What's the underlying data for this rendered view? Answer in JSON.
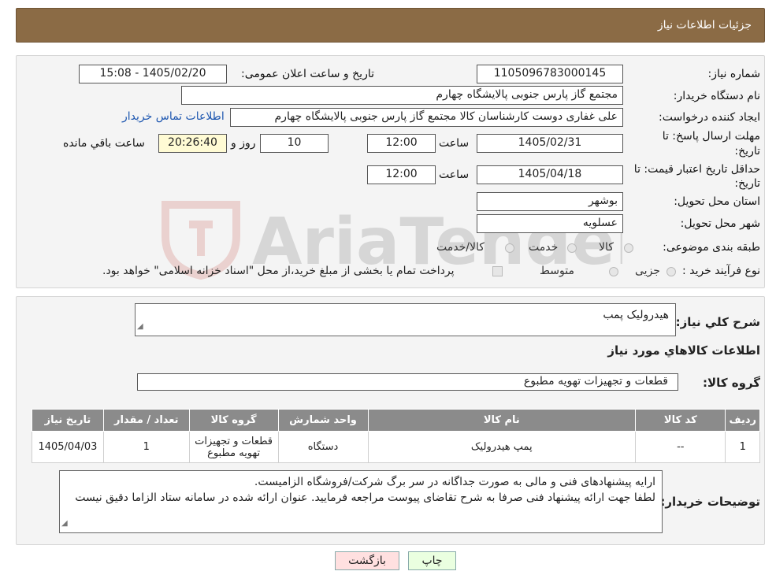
{
  "header": {
    "title": "جزئیات اطلاعات نیاز"
  },
  "form": {
    "need_number_label": "شماره نیاز:",
    "need_number": "1105096783000145",
    "announce_label": "تاریخ و ساعت اعلان عمومی:",
    "announce_value": "1405/02/20 - 15:08",
    "buyer_org_label": "نام دستگاه خریدار:",
    "buyer_org": "مجتمع گاز پارس جنوبی  پالایشگاه چهارم",
    "requester_label": "ایجاد کننده درخواست:",
    "requester": "علی غفاری دوست کارشناسان کالا مجتمع گاز پارس جنوبی  پالایشگاه چهارم",
    "contact_link": "اطلاعات تماس خریدار",
    "deadline_label_1": "مهلت ارسال پاسخ: تا",
    "deadline_label_2": "تاریخ:",
    "deadline_date": "1405/02/31",
    "time_label": "ساعت",
    "deadline_time": "12:00",
    "days_value": "10",
    "days_label": "روز و",
    "remaining_time": "20:26:40",
    "remaining_label": "ساعت باقي مانده",
    "validity_label_1": "حداقل تاریخ اعتبار قیمت: تا",
    "validity_label_2": "تاریخ:",
    "validity_date": "1405/04/18",
    "validity_time": "12:00",
    "province_label": "استان محل تحویل:",
    "province": "بوشهر",
    "city_label": "شهر محل تحویل:",
    "city": "عسلویه",
    "category_label": "طبقه بندی موضوعی:",
    "category_options": [
      "کالا",
      "خدمت",
      "کالا/خدمت"
    ],
    "process_label": "نوع فرآیند خرید :",
    "process_options": [
      "جزیی",
      "متوسط"
    ],
    "treasury_note": "پرداخت تمام یا بخشی از مبلغ خرید،از محل \"اسناد خزانه اسلامی\" خواهد بود."
  },
  "details": {
    "summary_label": "شرح کلي نياز:",
    "summary": "هیدرولیک پمب",
    "goods_info_title": "اطلاعات کالاهاي مورد نياز",
    "goods_group_label": "گروه کالا:",
    "goods_group": "قطعات و تجهیزات تهویه مطبوع",
    "table": {
      "headers": [
        "رديف",
        "کد کالا",
        "نام کالا",
        "واحد شمارش",
        "گروه کالا",
        "تعداد / مقدار",
        "تاریخ نیاز"
      ],
      "rows": [
        [
          "1",
          "--",
          "پمپ هیدرولیک",
          "دستگاه",
          "قطعات و تجهیزات تهویه مطبوع",
          "1",
          "1405/04/03"
        ]
      ]
    },
    "buyer_notes_label": "توضیحات خریدار:",
    "buyer_notes_line1": "ارایه پیشنهادهای فنی و مالی به صورت جداگانه در سر برگ شرکت/فروشگاه الزامیست.",
    "buyer_notes_line2": "لطفا جهت ارائه پیشنهاد فنی صرفا به شرح تقاضای پیوست مراجعه فرمایید. عنوان ارائه شده در سامانه ستاد الزاما دقیق نیست"
  },
  "buttons": {
    "print": "چاپ",
    "back": "بازگشت"
  },
  "watermark": {
    "text": "AriaTender.neT"
  },
  "colors": {
    "header_bg": "#8b6b45",
    "table_header_bg": "#8b8b8b",
    "back_btn_bg": "#ffe0e0",
    "print_btn_bg": "#eaffe0"
  }
}
